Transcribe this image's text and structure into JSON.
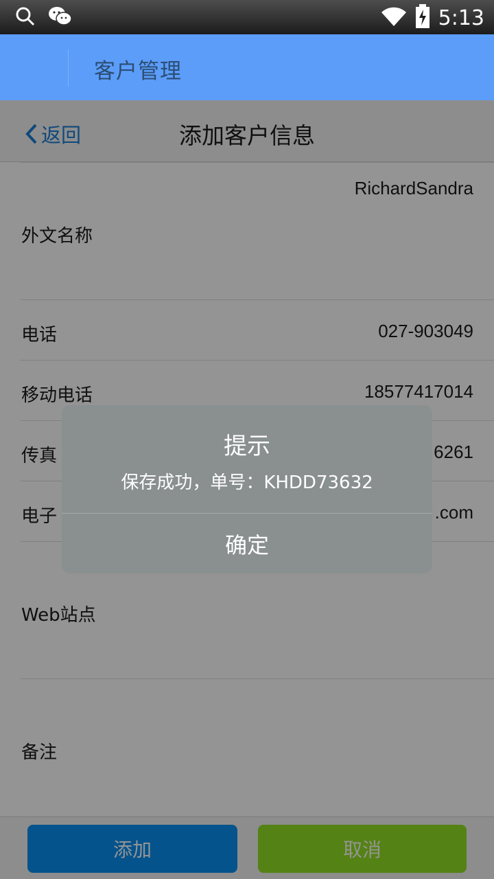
{
  "status_bar": {
    "time": "5:13",
    "icons": [
      "search-icon",
      "wechat-icon",
      "wifi-icon",
      "battery-charging-icon"
    ]
  },
  "app_bar": {
    "title": "客户管理"
  },
  "sub_header": {
    "back_label": "返回",
    "title": "添加客户信息"
  },
  "form": {
    "rows": [
      {
        "label": "",
        "value": "RichardSandra"
      },
      {
        "label": "外文名称",
        "value": ""
      },
      {
        "label": "电话",
        "value": "027-903049"
      },
      {
        "label": "移动电话",
        "value": "18577417014"
      },
      {
        "label": "传真",
        "value": "6261"
      },
      {
        "label": "电子",
        "value": ".com"
      },
      {
        "label": "Web站点",
        "value": ""
      },
      {
        "label": "备注",
        "value": ""
      }
    ]
  },
  "buttons": {
    "add": "添加",
    "cancel": "取消"
  },
  "dialog": {
    "title": "提示",
    "message": "保存成功，单号：KHDD73632",
    "ok": "确定"
  },
  "colors": {
    "app_bar": "#5c9df9",
    "add_button": "#0a8ff1",
    "cancel_button": "#91e024",
    "dialog_bg": "#8a8f8f"
  }
}
